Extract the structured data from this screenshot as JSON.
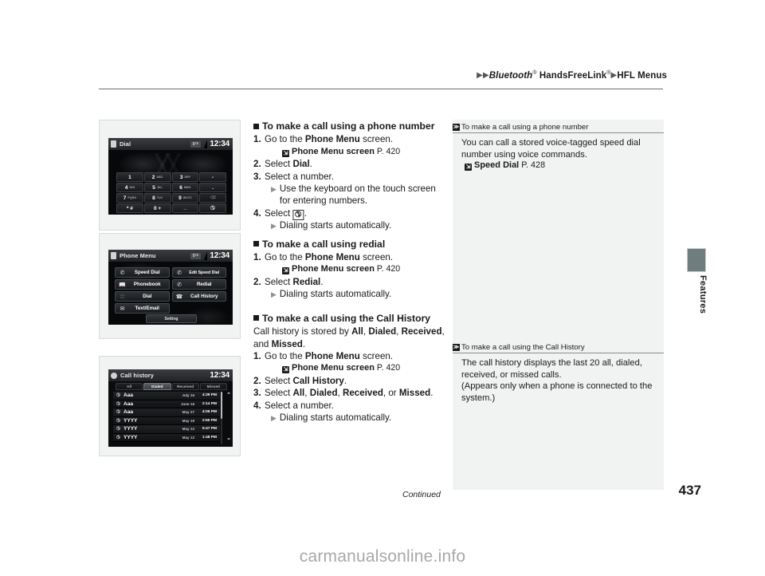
{
  "header": {
    "breadcrumb": {
      "arrow": "▶",
      "item1": "Bluetooth",
      "item1_sup": "®",
      "item2": "HandsFreeLink",
      "item2_sup": "®",
      "item3": "HFL Menus"
    }
  },
  "side_tab": {
    "label": "Features",
    "color": "#6f7d7e"
  },
  "screens": {
    "dial": {
      "status_title": "Dial",
      "signal": "0ᵀᴱ",
      "clock": "12:34",
      "keys": [
        {
          "digit": "1",
          "letters": ""
        },
        {
          "digit": "2",
          "letters": "ABC"
        },
        {
          "digit": "3",
          "letters": "DEF"
        },
        {
          "digit": "-",
          "letters": "",
          "side": true
        },
        {
          "digit": "4",
          "letters": "GHI"
        },
        {
          "digit": "5",
          "letters": "JKL"
        },
        {
          "digit": "6",
          "letters": "MNO"
        },
        {
          "digit": ".",
          "letters": "",
          "side": true
        },
        {
          "digit": "7",
          "letters": "PQRS"
        },
        {
          "digit": "8",
          "letters": "TUV"
        },
        {
          "digit": "9",
          "letters": "WXYZ"
        },
        {
          "digit": "⌫",
          "letters": "",
          "side": true,
          "dim": true
        },
        {
          "digit": "* #",
          "letters": ""
        },
        {
          "digit": "0 +",
          "letters": ""
        },
        {
          "digit": "_",
          "letters": "",
          "underscore": true
        },
        {
          "digit": "✆",
          "letters": "",
          "call": true
        }
      ]
    },
    "phone_menu": {
      "status_title": "Phone Menu",
      "signal": "0ᵀᴱ",
      "clock": "12:34",
      "buttons": [
        {
          "label": "Speed Dial",
          "icon": "phone-speed-icon"
        },
        {
          "label": "Edit Speed Dial",
          "icon": "phone-edit-speed-icon",
          "small": true
        },
        {
          "label": "Phonebook",
          "icon": "phonebook-icon"
        },
        {
          "label": "Redial",
          "icon": "redial-icon"
        },
        {
          "label": "Dial",
          "icon": "keypad-icon"
        },
        {
          "label": "Call History",
          "icon": "call-history-icon"
        },
        {
          "label": "Text/Email",
          "icon": "envelope-icon"
        }
      ],
      "setting_label": "Setting"
    },
    "call_history": {
      "status_title": "Call history",
      "clock": "12:34",
      "tabs": [
        "All",
        "Dialed",
        "Received",
        "Missed"
      ],
      "active_tab": "Dialed",
      "rows": [
        {
          "name": "Aaa",
          "date": "July 15",
          "time": "4:39 PM"
        },
        {
          "name": "Aaa",
          "date": "June 16",
          "time": "2:14 PM"
        },
        {
          "name": "Aaa",
          "date": "May 27",
          "time": "4:06 PM"
        },
        {
          "name": "YYYY",
          "date": "May 19",
          "time": "2:50 PM"
        },
        {
          "name": "YYYY",
          "date": "May 12",
          "time": "5:47 PM"
        },
        {
          "name": "YYYY",
          "date": "May 12",
          "time": "1:48 PM"
        }
      ],
      "scroll_up": "⌃",
      "scroll_down": "⌄"
    }
  },
  "main": {
    "section1": {
      "heading": "To make a call using a phone number",
      "step1_num": "1.",
      "step1_pre": "Go to the ",
      "step1_bold": "Phone Menu",
      "step1_post": " screen.",
      "ref_label": "Phone Menu screen",
      "ref_page": "P. 420",
      "step2_num": "2.",
      "step2_pre": "Select ",
      "step2_bold": "Dial",
      "step2_post": ".",
      "step3_num": "3.",
      "step3_text": "Select a number.",
      "step3_sub": "Use the keyboard on the touch screen for entering numbers.",
      "step4_num": "4.",
      "step4_pre": "Select ",
      "step4_key": "✆",
      "step4_post": ".",
      "step4_sub": "Dialing starts automatically."
    },
    "section2": {
      "heading": "To make a call using redial",
      "step1_num": "1.",
      "step1_pre": "Go to the ",
      "step1_bold": "Phone Menu",
      "step1_post": " screen.",
      "ref_label": "Phone Menu screen",
      "ref_page": "P. 420",
      "step2_num": "2.",
      "step2_pre": "Select ",
      "step2_bold": "Redial",
      "step2_post": ".",
      "step2_sub": "Dialing starts automatically."
    },
    "section3": {
      "heading": "To make a call using the Call History",
      "intro_a": "Call history is stored by ",
      "intro_b1": "All",
      "intro_c": ", ",
      "intro_b2": "Dialed",
      "intro_d": ", ",
      "intro_b3": "Received",
      "intro_e": ", and ",
      "intro_b4": "Missed",
      "intro_f": ".",
      "step1_num": "1.",
      "step1_pre": "Go to the ",
      "step1_bold": "Phone Menu",
      "step1_post": " screen.",
      "ref_label": "Phone Menu screen",
      "ref_page": "P. 420",
      "step2_num": "2.",
      "step2_pre": "Select ",
      "step2_bold": "Call History",
      "step2_post": ".",
      "step3_num": "3.",
      "step3_pre": "Select ",
      "step3_b1": "All",
      "step3_s1": ", ",
      "step3_b2": "Dialed",
      "step3_s2": ", ",
      "step3_b3": "Received",
      "step3_s3": ", or ",
      "step3_b4": "Missed",
      "step3_s4": ".",
      "step4_num": "4.",
      "step4_text": "Select a number.",
      "step4_sub": "Dialing starts automatically."
    }
  },
  "notes": {
    "note1": {
      "title": "To make a call using a phone number",
      "body": "You can call a stored voice-tagged speed dial number using voice commands.",
      "ref_label": "Speed Dial",
      "ref_page": "P. 428"
    },
    "note2": {
      "title": "To make a call using the Call History",
      "body_line1": "The call history displays the last 20 all, dialed, received, or missed calls.",
      "body_line2": "(Appears only when a phone is connected to the system.)"
    }
  },
  "footer": {
    "continued": "Continued",
    "page_number": "437",
    "watermark": "carmanualsonline.info"
  }
}
